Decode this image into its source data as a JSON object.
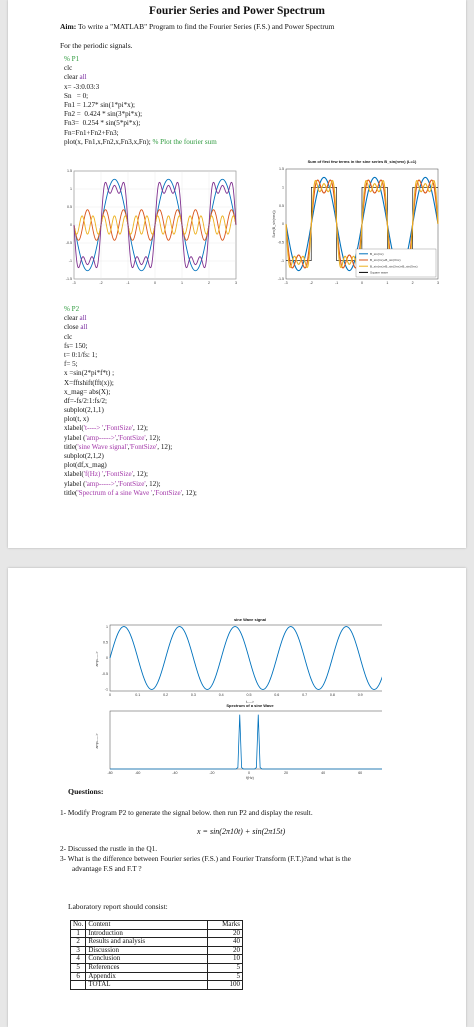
{
  "page1": {
    "title": "Fourier Series and Power Spectrum",
    "aim_label": "Aim:",
    "aim_text": "To write a \"MATLAB\" Program to find the Fourier Series (F.S.) and Power Spectrum",
    "aim_text2": "For the periodic signals.",
    "code_p1": [
      "% P1",
      "clc",
      "clear all",
      "x= -3:0.03:3",
      "Sn   = 0;",
      "Fn1 = 1.27* sin(1*pi*x);",
      "Fn2 =  0.424 * sin(3*pi*x);",
      "Fn3=  0.254 * sin(5*pi*x);",
      "Fn=Fn1+Fn2+Fn3;",
      "plot(x, Fn1,x,Fn2,x,Fn3,x,Fn); % Plot the fourier sum"
    ],
    "code_p2": [
      "% P2",
      "clear all",
      "close all",
      "clc",
      "fs= 150;",
      "t= 0:1/fs: 1;",
      "f= 5;",
      "x =sin(2*pi*f*t) ;",
      "X=fftshift(fft(x));",
      "x_mag= abs(X);",
      "df=-fs/2:1:fs/2;",
      "subplot(2,1,1)",
      "plot(t, x)",
      "xlabel('t----> ','FontSize', 12);",
      "ylabel ('amp----->','FontSize', 12);",
      "title('sine Wave signal','FontSize', 12);",
      "subplot(2,1,2)",
      "plot(df,x_mag)",
      "xlabel('f(Hz) ','FontSize', 12);",
      "ylabel ('amp----->','FontSize', 12);",
      "title('Spectrum of a sine Wave ','FontSize', 12);"
    ],
    "fig_left": {
      "yticks": [
        "1.5",
        "1",
        "0.5",
        "0",
        "-0.5",
        "-1",
        "-1.5"
      ],
      "xticks": [
        "-3",
        "-2",
        "-1",
        "0",
        "1",
        "2",
        "3"
      ],
      "colors": [
        "#0072bd",
        "#d95319",
        "#edb120",
        "#7e2f8e"
      ]
    },
    "fig_right": {
      "title": "Sum of first few terms in the sine series B_sin(nπx) (L=1)",
      "ylabel": "Sum(B_sin(nπx))",
      "yticks": [
        "1.5",
        "1",
        "0.5",
        "0",
        "-0.5",
        "-1",
        "-1.5"
      ],
      "xticks": [
        "-3",
        "-2",
        "-1",
        "0",
        "1",
        "2",
        "3"
      ],
      "legend": [
        "B_sin(πx)",
        "B_sin(πx)+B_sin(3πx)",
        "B_sin(πx)+B_sin(3πx)+B_sin(5πx)",
        "Square wave"
      ],
      "colors": [
        "#0072bd",
        "#d95319",
        "#edb120",
        "#000000"
      ]
    }
  },
  "page2": {
    "fig_top": {
      "title": "sine Wave signal",
      "xlabel": "t---->",
      "ylabel": "amp----->",
      "yticks": [
        "1",
        "0.5",
        "0",
        "-0.5",
        "-1"
      ],
      "xticks": [
        "0",
        "0.1",
        "0.2",
        "0.3",
        "0.4",
        "0.5",
        "0.6",
        "0.7",
        "0.8",
        "0.9",
        "1"
      ]
    },
    "fig_bottom": {
      "title": "Spectrum of a sine Wave",
      "xlabel": "f(Hz)",
      "ylabel": "amp----->",
      "xticks": [
        "-80",
        "-60",
        "-40",
        "-20",
        "0",
        "20",
        "40",
        "60",
        "80"
      ]
    },
    "questions_heading": "Questions:",
    "q1": "1-  Modify Program P2 to generate the signal below. then run P2 and display the result.",
    "equation": "x = sin(2π10t) + sin(2π15t)",
    "q2": "2-  Discussed the rustle in the Q1.",
    "q3a": "3-  What is the difference between Fourier series (F.S.) and Fourier Transform (F.T.)?and what is the",
    "q3b": "advantage F.S and F.T ?",
    "lab_heading": "Laboratory report should consist:",
    "table": {
      "headers": [
        "No.",
        "Content",
        "Marks"
      ],
      "rows": [
        [
          "1",
          "Introduction",
          "20"
        ],
        [
          "2",
          "Results and analysis",
          "40"
        ],
        [
          "3",
          "Discussion",
          "20"
        ],
        [
          "4",
          "Conclusion",
          "10"
        ],
        [
          "5",
          "References",
          "5"
        ],
        [
          "6",
          "Appendix",
          "5"
        ],
        [
          "",
          "TOTAL",
          "100"
        ]
      ]
    }
  }
}
